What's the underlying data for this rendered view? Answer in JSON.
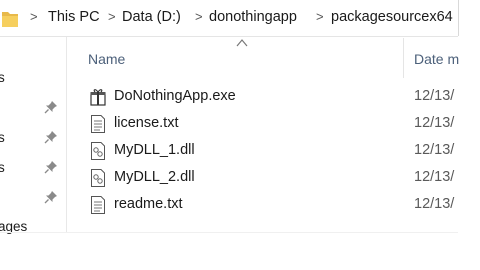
{
  "address_bar": {
    "crumbs": [
      "This PC",
      "Data (D:)",
      "donothingapp",
      "packagesourcex64"
    ]
  },
  "nav_pane": {
    "labels": [
      "s",
      "s",
      "s",
      "ages"
    ]
  },
  "columns": {
    "name": "Name",
    "date": "Date m"
  },
  "files": [
    {
      "name": "DoNothingApp.exe",
      "date": "12/13/",
      "icon": "exe-icon"
    },
    {
      "name": "license.txt",
      "date": "12/13/",
      "icon": "text-file-icon"
    },
    {
      "name": "MyDLL_1.dll",
      "date": "12/13/",
      "icon": "dll-file-icon"
    },
    {
      "name": "MyDLL_2.dll",
      "date": "12/13/",
      "icon": "dll-file-icon"
    },
    {
      "name": "readme.txt",
      "date": "12/13/",
      "icon": "text-file-icon"
    }
  ]
}
